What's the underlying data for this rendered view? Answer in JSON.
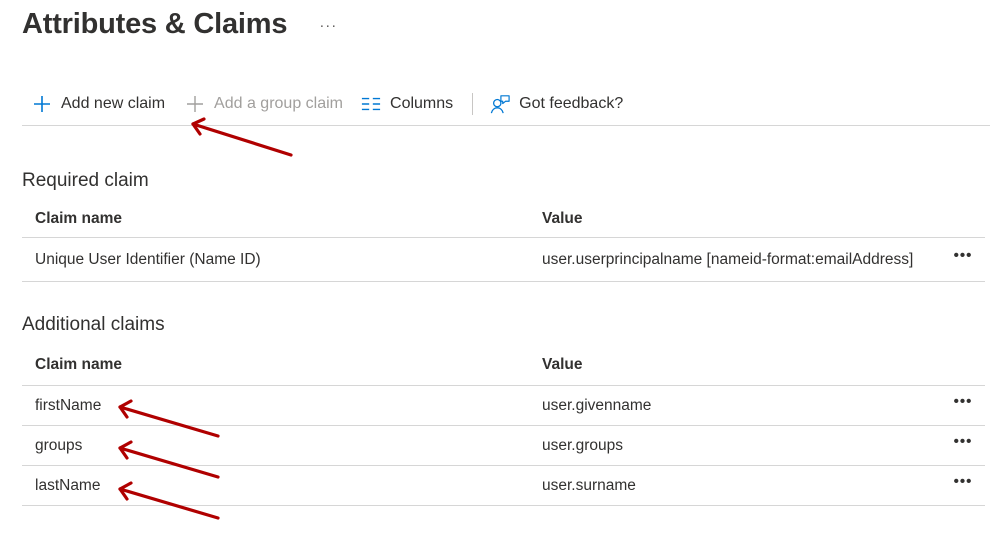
{
  "header": {
    "title": "Attributes & Claims",
    "more_label": "···"
  },
  "toolbar": {
    "add_new_claim": "Add new claim",
    "add_group_claim": "Add a group claim",
    "columns": "Columns",
    "got_feedback": "Got feedback?"
  },
  "required": {
    "title": "Required claim",
    "columns": {
      "name": "Claim name",
      "value": "Value"
    },
    "rows": [
      {
        "name": "Unique User Identifier (Name ID)",
        "value": "user.userprincipalname [nameid-format:emailAddress]",
        "more": "•••"
      }
    ]
  },
  "additional": {
    "title": "Additional claims",
    "columns": {
      "name": "Claim name",
      "value": "Value"
    },
    "rows": [
      {
        "name": "firstName",
        "value": "user.givenname",
        "more": "•••"
      },
      {
        "name": "groups",
        "value": "user.groups",
        "more": "•••"
      },
      {
        "name": "lastName",
        "value": "user.surname",
        "more": "•••"
      }
    ]
  },
  "colors": {
    "accent": "#0078d4",
    "annotation_arrow": "#b00000",
    "disabled_text": "#a19f9d",
    "divider": "#d6d6d6"
  }
}
